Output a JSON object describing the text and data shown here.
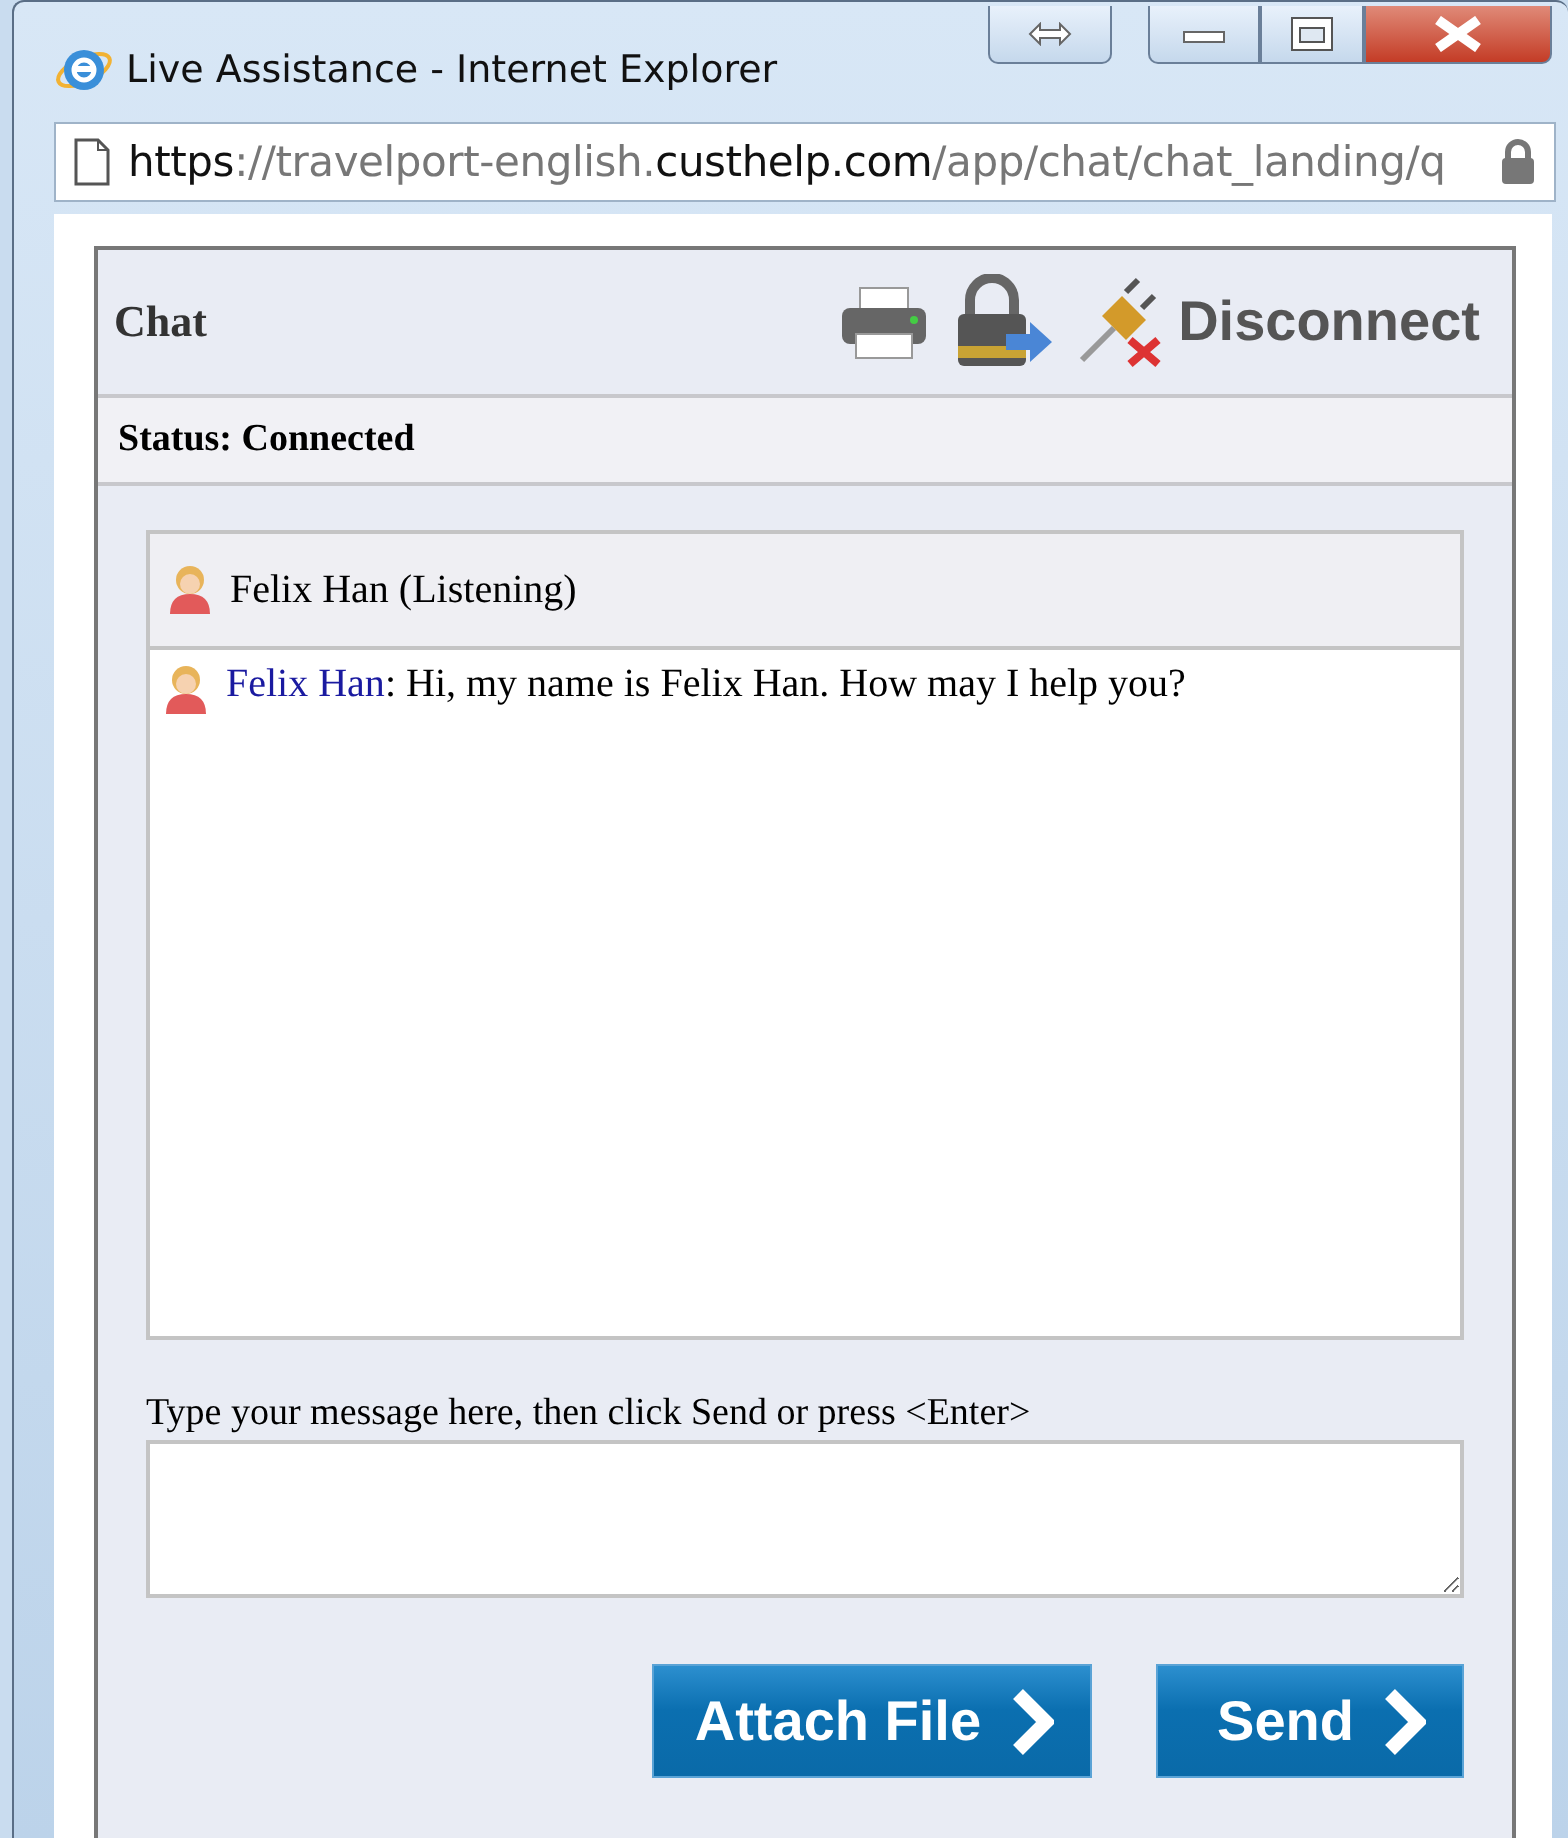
{
  "window": {
    "title": "Live Assistance - Internet Explorer"
  },
  "address_bar": {
    "url": [
      {
        "text": "https",
        "strong": true
      },
      {
        "text": "://travelport-english.",
        "strong": false
      },
      {
        "text": "custhelp.com",
        "strong": true
      },
      {
        "text": "/app/chat/chat_landing/q",
        "strong": false
      }
    ]
  },
  "chat": {
    "title": "Chat",
    "disconnect": "Disconnect",
    "status": "Status: Connected",
    "participants": [
      {
        "label": "Felix Han (Listening)"
      }
    ],
    "messages": [
      {
        "sender": "Felix Han",
        "text": ": Hi, my name is Felix Han. How may I help you?"
      }
    ],
    "input_label": "Type your message here, then click Send or press <Enter>",
    "buttons": [
      {
        "label": "Attach File"
      },
      {
        "label": "Send"
      }
    ]
  }
}
